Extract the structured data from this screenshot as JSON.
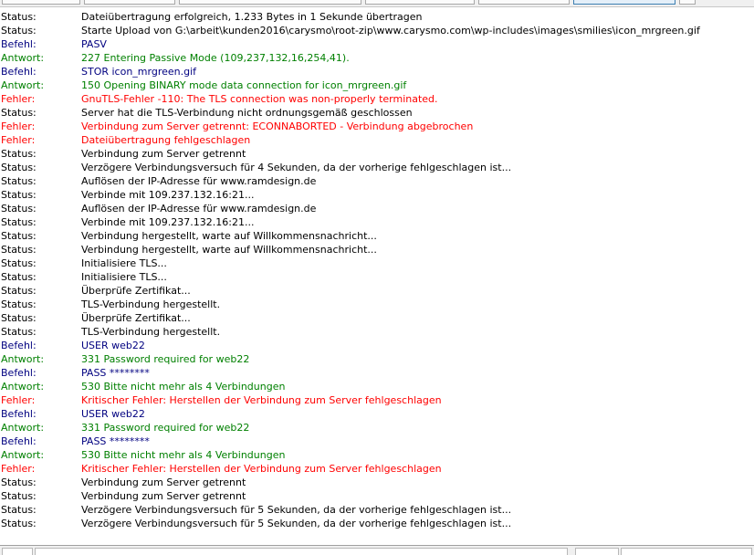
{
  "colors": {
    "status": "#000000",
    "command": "#000080",
    "response": "#008000",
    "error": "#ff0000"
  },
  "log": [
    {
      "type": "status",
      "label": "Status:",
      "text": "Dateiübertragung erfolgreich, 1.233 Bytes in 1 Sekunde übertragen"
    },
    {
      "type": "status",
      "label": "Status:",
      "text": "Starte Upload von G:\\arbeit\\kunden2016\\carysmo\\root-zip\\www.carysmo.com\\wp-includes\\images\\smilies\\icon_mrgreen.gif"
    },
    {
      "type": "command",
      "label": "Befehl:",
      "text": "PASV"
    },
    {
      "type": "response",
      "label": "Antwort:",
      "text": "227 Entering Passive Mode (109,237,132,16,254,41)."
    },
    {
      "type": "command",
      "label": "Befehl:",
      "text": "STOR icon_mrgreen.gif"
    },
    {
      "type": "response",
      "label": "Antwort:",
      "text": "150 Opening BINARY mode data connection for icon_mrgreen.gif"
    },
    {
      "type": "error",
      "label": "Fehler:",
      "text": "GnuTLS-Fehler -110: The TLS connection was non-properly terminated."
    },
    {
      "type": "status",
      "label": "Status:",
      "text": "Server hat die TLS-Verbindung nicht ordnungsgemäß geschlossen"
    },
    {
      "type": "error",
      "label": "Fehler:",
      "text": "Verbindung zum Server getrennt: ECONNABORTED - Verbindung abgebrochen"
    },
    {
      "type": "error",
      "label": "Fehler:",
      "text": "Dateiübertragung fehlgeschlagen"
    },
    {
      "type": "status",
      "label": "Status:",
      "text": "Verbindung zum Server getrennt"
    },
    {
      "type": "status",
      "label": "Status:",
      "text": "Verzögere Verbindungsversuch für 4 Sekunden, da der vorherige fehlgeschlagen ist..."
    },
    {
      "type": "status",
      "label": "Status:",
      "text": "Auflösen der IP-Adresse für www.ramdesign.de"
    },
    {
      "type": "status",
      "label": "Status:",
      "text": "Verbinde mit 109.237.132.16:21..."
    },
    {
      "type": "status",
      "label": "Status:",
      "text": "Auflösen der IP-Adresse für www.ramdesign.de"
    },
    {
      "type": "status",
      "label": "Status:",
      "text": "Verbinde mit 109.237.132.16:21..."
    },
    {
      "type": "status",
      "label": "Status:",
      "text": "Verbindung hergestellt, warte auf Willkommensnachricht..."
    },
    {
      "type": "status",
      "label": "Status:",
      "text": "Verbindung hergestellt, warte auf Willkommensnachricht..."
    },
    {
      "type": "status",
      "label": "Status:",
      "text": "Initialisiere TLS..."
    },
    {
      "type": "status",
      "label": "Status:",
      "text": "Initialisiere TLS..."
    },
    {
      "type": "status",
      "label": "Status:",
      "text": "Überprüfe Zertifikat..."
    },
    {
      "type": "status",
      "label": "Status:",
      "text": "TLS-Verbindung hergestellt."
    },
    {
      "type": "status",
      "label": "Status:",
      "text": "Überprüfe Zertifikat..."
    },
    {
      "type": "status",
      "label": "Status:",
      "text": "TLS-Verbindung hergestellt."
    },
    {
      "type": "command",
      "label": "Befehl:",
      "text": "USER web22"
    },
    {
      "type": "response",
      "label": "Antwort:",
      "text": "331 Password required for web22"
    },
    {
      "type": "command",
      "label": "Befehl:",
      "text": "PASS ********"
    },
    {
      "type": "response",
      "label": "Antwort:",
      "text": "530 Bitte nicht mehr als 4 Verbindungen"
    },
    {
      "type": "error",
      "label": "Fehler:",
      "text": "Kritischer Fehler: Herstellen der Verbindung zum Server fehlgeschlagen"
    },
    {
      "type": "command",
      "label": "Befehl:",
      "text": "USER web22"
    },
    {
      "type": "response",
      "label": "Antwort:",
      "text": "331 Password required for web22"
    },
    {
      "type": "command",
      "label": "Befehl:",
      "text": "PASS ********"
    },
    {
      "type": "response",
      "label": "Antwort:",
      "text": "530 Bitte nicht mehr als 4 Verbindungen"
    },
    {
      "type": "error",
      "label": "Fehler:",
      "text": "Kritischer Fehler: Herstellen der Verbindung zum Server fehlgeschlagen"
    },
    {
      "type": "status",
      "label": "Status:",
      "text": "Verbindung zum Server getrennt"
    },
    {
      "type": "status",
      "label": "Status:",
      "text": "Verbindung zum Server getrennt"
    },
    {
      "type": "status",
      "label": "Status:",
      "text": "Verzögere Verbindungsversuch für 5 Sekunden, da der vorherige fehlgeschlagen ist..."
    },
    {
      "type": "status",
      "label": "Status:",
      "text": "Verzögere Verbindungsversuch für 5 Sekunden, da der vorherige fehlgeschlagen ist..."
    }
  ]
}
